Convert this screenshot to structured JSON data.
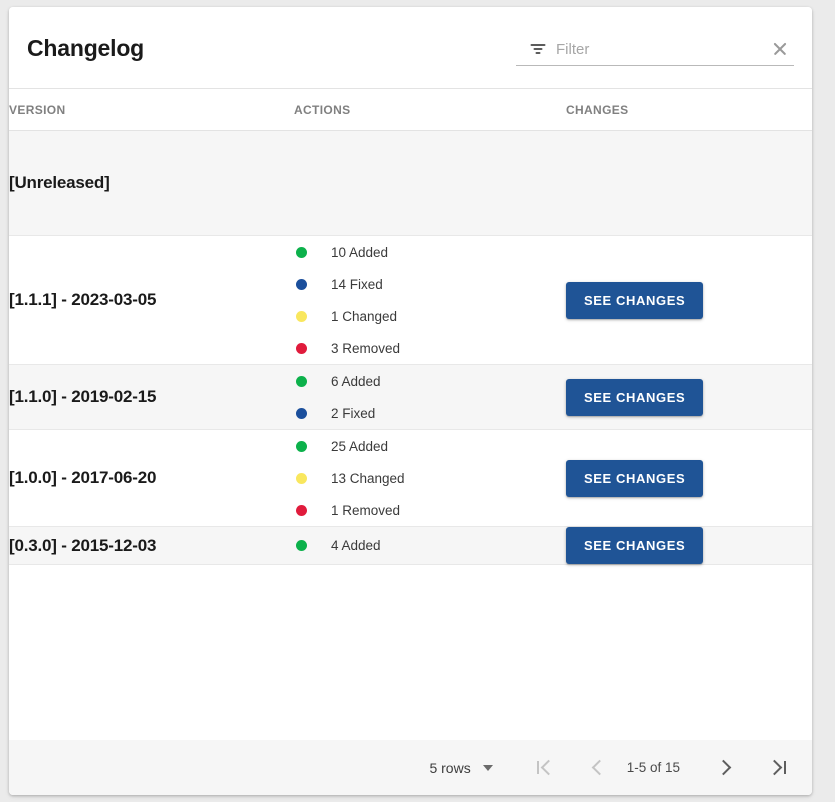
{
  "toolbar": {
    "title": "Changelog",
    "filter_placeholder": "Filter",
    "filter_value": "",
    "filter_icon": "filter-list-icon",
    "clear_icon": "close-icon"
  },
  "table": {
    "columns": [
      {
        "key": "version",
        "label": "VERSION"
      },
      {
        "key": "actions",
        "label": "ACTIONS"
      },
      {
        "key": "changes",
        "label": "CHANGES"
      }
    ],
    "button_label": "SEE CHANGES",
    "rows": [
      {
        "version": "[Unreleased]",
        "actions": [],
        "has_button": false
      },
      {
        "version": "[1.1.1] - 2023-03-05",
        "actions": [
          {
            "count": "10",
            "type": "Added",
            "label": "10 Added",
            "color": "#0cb14b"
          },
          {
            "count": "14",
            "type": "Fixed",
            "label": "14 Fixed",
            "color": "#1b4f9c"
          },
          {
            "count": "1",
            "type": "Changed",
            "label": "1 Changed",
            "color": "#f9e75e"
          },
          {
            "count": "3",
            "type": "Removed",
            "label": "3 Removed",
            "color": "#e01b3c"
          }
        ],
        "has_button": true
      },
      {
        "version": "[1.1.0] - 2019-02-15",
        "actions": [
          {
            "count": "6",
            "type": "Added",
            "label": "6 Added",
            "color": "#0cb14b"
          },
          {
            "count": "2",
            "type": "Fixed",
            "label": "2 Fixed",
            "color": "#1b4f9c"
          }
        ],
        "has_button": true
      },
      {
        "version": "[1.0.0] - 2017-06-20",
        "actions": [
          {
            "count": "25",
            "type": "Added",
            "label": "25 Added",
            "color": "#0cb14b"
          },
          {
            "count": "13",
            "type": "Changed",
            "label": "13 Changed",
            "color": "#f9e75e"
          },
          {
            "count": "1",
            "type": "Removed",
            "label": "1 Removed",
            "color": "#e01b3c"
          }
        ],
        "has_button": true
      },
      {
        "version": "[0.3.0] - 2015-12-03",
        "actions": [
          {
            "count": "4",
            "type": "Added",
            "label": "4 Added",
            "color": "#0cb14b"
          }
        ],
        "has_button": true
      }
    ]
  },
  "pagination": {
    "rows_per_page_label": "5 rows",
    "range_label": "1-5 of 15",
    "first_page_icon": "first-page-icon",
    "prev_page_icon": "previous-page-icon",
    "next_page_icon": "next-page-icon",
    "last_page_icon": "last-page-icon",
    "first_enabled": false,
    "prev_enabled": false,
    "next_enabled": true,
    "last_enabled": true
  },
  "theme": {
    "button_color": "#1f5496",
    "row_shade": "#f6f6f6",
    "row_plain": "#ffffff"
  }
}
